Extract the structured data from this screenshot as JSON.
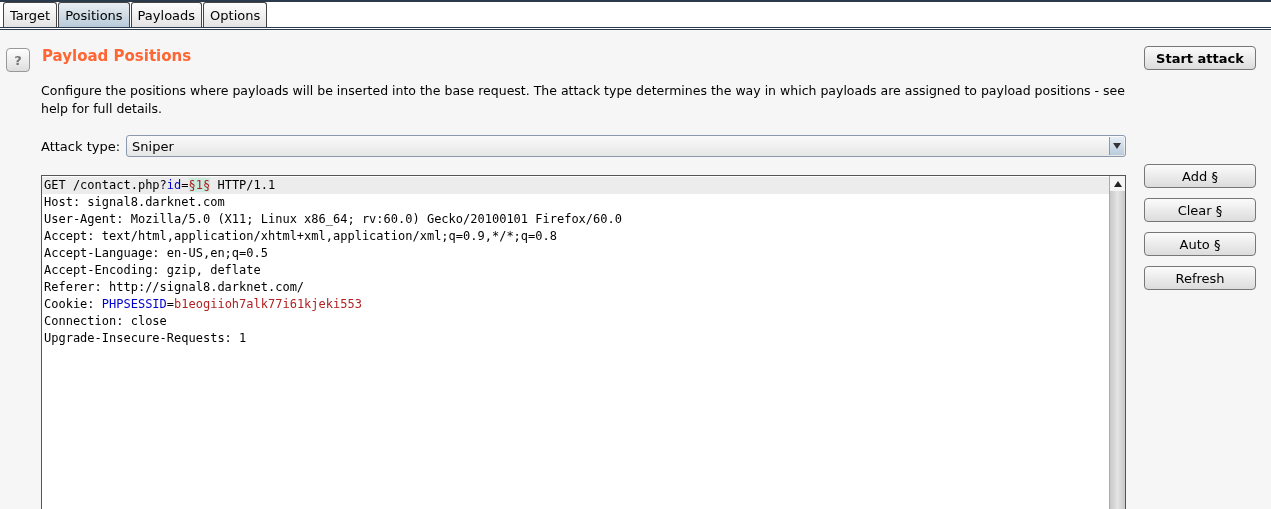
{
  "tabs": [
    {
      "label": "Target",
      "selected": false
    },
    {
      "label": "Positions",
      "selected": true
    },
    {
      "label": "Payloads",
      "selected": false
    },
    {
      "label": "Options",
      "selected": false
    }
  ],
  "help_button": "?",
  "title": "Payload Positions",
  "description": "Configure the positions where payloads will be inserted into the base request. The attack type determines the way in which payloads are assigned to payload positions - see help for full details.",
  "start_button": "Start attack",
  "attack_type": {
    "label": "Attack type:",
    "value": "Sniper"
  },
  "request_lines": [
    {
      "highlighted": true,
      "segments": [
        {
          "kind": "plain",
          "text": "GET /contact.php?"
        },
        {
          "kind": "name",
          "text": "id"
        },
        {
          "kind": "plain",
          "text": "="
        },
        {
          "kind": "marker",
          "text": "§1§"
        },
        {
          "kind": "plain",
          "text": " HTTP/1.1"
        }
      ]
    },
    {
      "highlighted": false,
      "segments": [
        {
          "kind": "plain",
          "text": "Host: signal8.darknet.com"
        }
      ]
    },
    {
      "highlighted": false,
      "segments": [
        {
          "kind": "plain",
          "text": "User-Agent: Mozilla/5.0 (X11; Linux x86_64; rv:60.0) Gecko/20100101 Firefox/60.0"
        }
      ]
    },
    {
      "highlighted": false,
      "segments": [
        {
          "kind": "plain",
          "text": "Accept: text/html,application/xhtml+xml,application/xml;q=0.9,*/*;q=0.8"
        }
      ]
    },
    {
      "highlighted": false,
      "segments": [
        {
          "kind": "plain",
          "text": "Accept-Language: en-US,en;q=0.5"
        }
      ]
    },
    {
      "highlighted": false,
      "segments": [
        {
          "kind": "plain",
          "text": "Accept-Encoding: gzip, deflate"
        }
      ]
    },
    {
      "highlighted": false,
      "segments": [
        {
          "kind": "plain",
          "text": "Referer: http://signal8.darknet.com/"
        }
      ]
    },
    {
      "highlighted": false,
      "segments": [
        {
          "kind": "plain",
          "text": "Cookie: "
        },
        {
          "kind": "name",
          "text": "PHPSESSID"
        },
        {
          "kind": "plain",
          "text": "="
        },
        {
          "kind": "value",
          "text": "b1eogiioh7alk77i61kjeki553"
        }
      ]
    },
    {
      "highlighted": false,
      "segments": [
        {
          "kind": "plain",
          "text": "Connection: close"
        }
      ]
    },
    {
      "highlighted": false,
      "segments": [
        {
          "kind": "plain",
          "text": "Upgrade-Insecure-Requests: 1"
        }
      ]
    }
  ],
  "side_buttons": [
    "Add §",
    "Clear §",
    "Auto §",
    "Refresh"
  ]
}
